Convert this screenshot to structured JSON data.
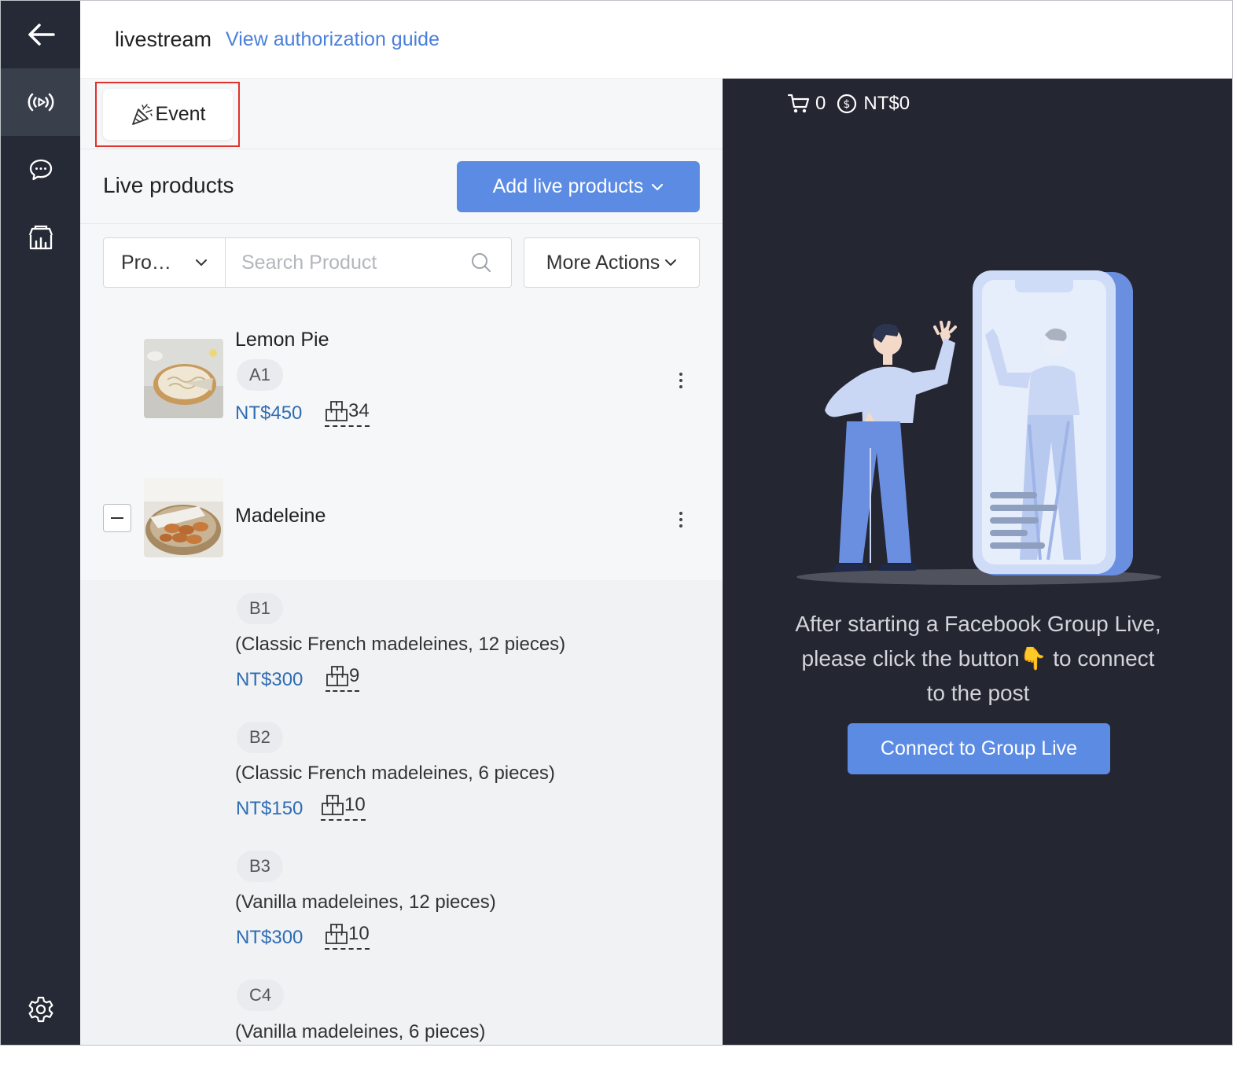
{
  "header": {
    "title": "livestream",
    "guide_link": "View authorization guide"
  },
  "sidebar": {
    "items": [
      {
        "icon": "back-arrow-icon"
      },
      {
        "icon": "live-broadcast-icon",
        "active": true
      },
      {
        "icon": "chat-bubble-icon"
      },
      {
        "icon": "store-analytics-icon"
      },
      {
        "icon": "settings-gear-icon"
      }
    ]
  },
  "toolbar": {
    "event_label": "Event"
  },
  "live_products": {
    "title": "Live products",
    "add_button": "Add live products",
    "filter_select": "Pro…",
    "search_placeholder": "Search Product",
    "more_actions": "More Actions"
  },
  "products": [
    {
      "name": "Lemon Pie",
      "code": "A1",
      "price": "NT$450",
      "stock": "34"
    },
    {
      "name": "Madeleine",
      "expanded": true
    }
  ],
  "variants": [
    {
      "code": "B1",
      "desc": "(Classic French madeleines, 12 pieces)",
      "price": "NT$300",
      "stock": "9"
    },
    {
      "code": "B2",
      "desc": "(Classic French madeleines, 6 pieces)",
      "price": "NT$150",
      "stock": "10"
    },
    {
      "code": "B3",
      "desc": "(Vanilla madeleines, 12 pieces)",
      "price": "NT$300",
      "stock": "10"
    },
    {
      "code": "C4",
      "desc": "(Vanilla madeleines, 6 pieces)"
    }
  ],
  "live_panel": {
    "cart_count": "0",
    "total": "NT$0",
    "message_line1": "After starting a Facebook Group Live,",
    "message_line2_a": "please click the button",
    "message_line2_b": " to connect",
    "message_line3": "to the post",
    "pointer_emoji": "👇",
    "connect_button": "Connect to Group Live"
  },
  "colors": {
    "sidebar_bg": "#262a36",
    "accent": "#5b8be3",
    "link": "#4a7fdb",
    "price": "#2f6db4",
    "right_bg": "#242632",
    "highlight": "#e0322a"
  }
}
